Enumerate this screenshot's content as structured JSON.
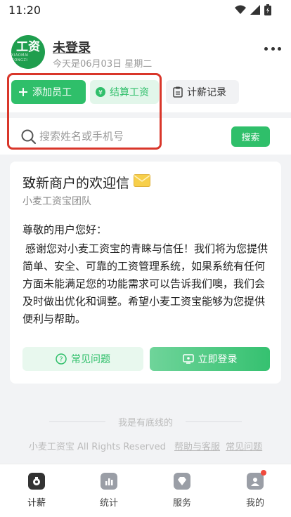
{
  "status_bar": {
    "time": "11:20"
  },
  "header": {
    "logo_text": "工资",
    "logo_subtext": "XIAOMAI GONGZI",
    "login_title": "未登录",
    "date_line": "今天是06月03日 星期二"
  },
  "actions": {
    "add_employee": "添加员工",
    "settle_salary": "结算工资",
    "payroll_records": "计薪记录"
  },
  "search": {
    "placeholder": "搜索姓名或手机号",
    "button": "搜索"
  },
  "welcome_card": {
    "title": "致新商户的欢迎信",
    "subtitle": "小麦工资宝团队",
    "greeting": "尊敬的用户您好：",
    "body": "感谢您对小麦工资宝的青睐与信任！我们将为您提供简单、安全、可靠的工资管理系统，如果系统有任何方面未能满足您的功能需求可以告诉我们噢，我们会及时做出优化和调整。希望小麦工资宝能够为您提供便利与帮助。",
    "faq_button": "常见问题",
    "login_button": "立即登录"
  },
  "footer": {
    "bottom_line": "我是有底线的",
    "rights": "小麦工资宝 All Rights Reserved",
    "help_link": "帮助与客服",
    "faq_link": "常见问题"
  },
  "tabs": [
    {
      "label": "计薪",
      "icon": "payroll-icon",
      "active": true
    },
    {
      "label": "统计",
      "icon": "stats-icon",
      "active": false
    },
    {
      "label": "服务",
      "icon": "service-icon",
      "active": false
    },
    {
      "label": "我的",
      "icon": "profile-icon",
      "active": false
    }
  ],
  "colors": {
    "brand_green": "#2fbf6a",
    "highlight_red": "#d9362a"
  }
}
